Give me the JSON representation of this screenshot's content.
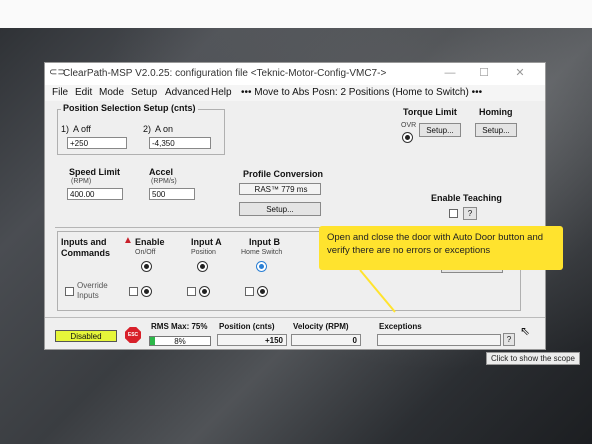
{
  "window": {
    "title": "ClearPath-MSP V2.0.25: configuration file <Teknic-Motor-Config-VMC7->",
    "controls": {
      "minimize": "—",
      "maximize": "☐",
      "close": "✕"
    }
  },
  "menu": {
    "items": [
      "File",
      "Edit",
      "Mode",
      "Setup",
      "Advanced",
      "Help"
    ],
    "move_status": "••• Move to Abs Posn: 2 Positions (Home to Switch) •••"
  },
  "position_setup": {
    "group_label": "Position Selection Setup (cnts)",
    "a_off_number": "1)",
    "a_off_label": "A off",
    "a_off_value": "+250",
    "a_on_number": "2)",
    "a_on_label": "A on",
    "a_on_value": "-4,350"
  },
  "torque_limit": {
    "label": "Torque Limit",
    "ovr_label": "OVR",
    "button": "Setup..."
  },
  "homing": {
    "label": "Homing",
    "button": "Setup..."
  },
  "speed_limit": {
    "label": "Speed Limit",
    "unit": "(RPM)",
    "value": "400.00"
  },
  "accel": {
    "label": "Accel",
    "unit": "(RPM/s)",
    "value": "500"
  },
  "profile_conversion": {
    "label": "Profile Conversion",
    "value": "RAS™ 779 ms",
    "button": "Setup..."
  },
  "enable_teaching": {
    "label": "Enable Teaching",
    "help": "?"
  },
  "inputs": {
    "header": "Inputs and Commands",
    "enable_label": "Enable",
    "enable_sub": "On/Off",
    "input_a_label": "Input A",
    "input_a_sub": "Position",
    "input_b_label": "Input B",
    "input_b_sub": "Home Switch",
    "override_label": "Override Inputs",
    "servo_button": "Servo Off"
  },
  "status": {
    "disabled_label": "Disabled",
    "stop_label": "ESC",
    "rms_label": "RMS Max: 75%",
    "rms_value": "8%",
    "rms_fraction": 0.08,
    "position_label": "Position (cnts)",
    "position_value": "+150",
    "velocity_label": "Velocity (RPM)",
    "velocity_value": "0",
    "exceptions_label": "Exceptions",
    "exceptions_value": "",
    "help": "?"
  },
  "callout": {
    "text": "Open and close the door with Auto Door button and verify there are no errors or exceptions"
  },
  "tooltip": {
    "text": "Click to show the scope"
  },
  "colors": {
    "status_disabled": "#e6f63a",
    "stop": "#d8202a",
    "rms_fill": "#2db84a",
    "callout": "#ffe32e",
    "accent_blue": "#2a7fd4"
  }
}
